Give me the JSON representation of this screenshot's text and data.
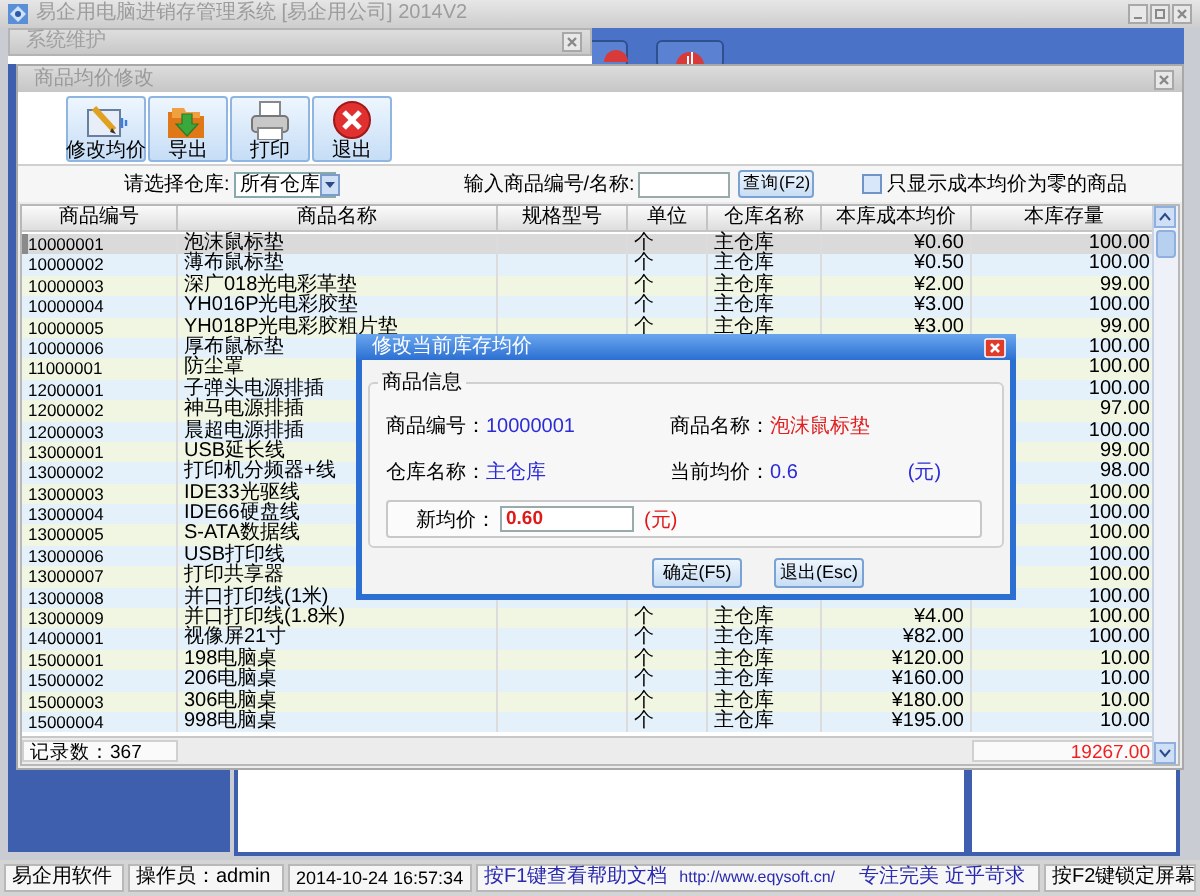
{
  "app_window": {
    "title": "易企用电脑进销存管理系统 [易企用公司] 2014V2"
  },
  "back_window": {
    "title": "系统维护"
  },
  "price_window": {
    "title": "商品均价修改",
    "toolbar": [
      {
        "label": "修改均价",
        "kind": "edit"
      },
      {
        "label": "导出",
        "kind": "export"
      },
      {
        "label": "打印",
        "kind": "print"
      },
      {
        "label": "退出",
        "kind": "exit"
      }
    ],
    "filter": {
      "warehouse_label": "请选择仓库:",
      "warehouse": "所有仓库",
      "search_label": "输入商品编号/名称:",
      "search_button": "查询(F2)",
      "only_zero_cost": {
        "label": "只显示成本均价为零的商品",
        "checked": false
      }
    },
    "table": {
      "columns": [
        "商品编号",
        "商品名称",
        "规格型号",
        "单位",
        "仓库名称",
        "本库成本均价",
        "本库存量"
      ],
      "rows": [
        {
          "code": "10000001",
          "name": "泡沫鼠标垫",
          "unit": "个",
          "warehouse": "主仓库",
          "price": "¥0.60",
          "stock": "100.00",
          "selected": true
        },
        {
          "code": "10000002",
          "name": "薄布鼠标垫",
          "unit": "个",
          "warehouse": "主仓库",
          "price": "¥0.50",
          "stock": "100.00",
          "selected": false
        },
        {
          "code": "10000003",
          "name": "深广018光电彩革垫",
          "unit": "个",
          "warehouse": "主仓库",
          "price": "¥2.00",
          "stock": "99.00",
          "selected": false
        },
        {
          "code": "10000004",
          "name": "YH016P光电彩胶垫",
          "unit": "个",
          "warehouse": "主仓库",
          "price": "¥3.00",
          "stock": "100.00",
          "selected": false
        },
        {
          "code": "10000005",
          "name": "YH018P光电彩胶粗片垫",
          "unit": "个",
          "warehouse": "主仓库",
          "price": "¥3.00",
          "stock": "99.00",
          "selected": false
        },
        {
          "code": "10000006",
          "name": "厚布鼠标垫",
          "stock": "100.00",
          "selected": false
        },
        {
          "code": "11000001",
          "name": "防尘罩",
          "stock": "100.00",
          "selected": false
        },
        {
          "code": "12000001",
          "name": "子弹头电源排插",
          "stock": "100.00",
          "selected": false
        },
        {
          "code": "12000002",
          "name": "神马电源排插",
          "stock": "97.00",
          "selected": false
        },
        {
          "code": "12000003",
          "name": "晨超电源排插",
          "stock": "100.00",
          "selected": false
        },
        {
          "code": "13000001",
          "name": "USB延长线",
          "stock": "99.00",
          "selected": false
        },
        {
          "code": "13000002",
          "name": "打印机分频器+线",
          "stock": "98.00",
          "selected": false
        },
        {
          "code": "13000003",
          "name": "IDE33光驱线",
          "stock": "100.00",
          "selected": false
        },
        {
          "code": "13000004",
          "name": "IDE66硬盘线",
          "stock": "100.00",
          "selected": false
        },
        {
          "code": "13000005",
          "name": "S-ATA数据线",
          "stock": "100.00",
          "selected": false
        },
        {
          "code": "13000006",
          "name": "USB打印线",
          "stock": "100.00",
          "selected": false
        },
        {
          "code": "13000007",
          "name": "打印共享器",
          "stock": "100.00",
          "selected": false
        },
        {
          "code": "13000008",
          "name": "并口打印线(1米)",
          "stock": "100.00",
          "selected": false
        },
        {
          "code": "13000009",
          "name": "并口打印线(1.8米)",
          "unit": "个",
          "warehouse": "主仓库",
          "price": "¥4.00",
          "stock": "100.00",
          "selected": false
        },
        {
          "code": "14000001",
          "name": "视像屏21寸",
          "unit": "个",
          "warehouse": "主仓库",
          "price": "¥82.00",
          "stock": "100.00",
          "selected": false
        },
        {
          "code": "15000001",
          "name": "198电脑桌",
          "unit": "个",
          "warehouse": "主仓库",
          "price": "¥120.00",
          "stock": "10.00",
          "selected": false
        },
        {
          "code": "15000002",
          "name": "206电脑桌",
          "unit": "个",
          "warehouse": "主仓库",
          "price": "¥160.00",
          "stock": "10.00",
          "selected": false
        },
        {
          "code": "15000003",
          "name": "306电脑桌",
          "unit": "个",
          "warehouse": "主仓库",
          "price": "¥180.00",
          "stock": "10.00",
          "selected": false
        },
        {
          "code": "15000004",
          "name": "998电脑桌",
          "unit": "个",
          "warehouse": "主仓库",
          "price": "¥195.00",
          "stock": "10.00",
          "selected": false
        }
      ]
    },
    "record_count": "记录数：367",
    "stock_total": "19267.00"
  },
  "dialog": {
    "title": "修改当前库存均价",
    "group": "商品信息",
    "fields": [
      {
        "label": "商品编号：",
        "value": "10000001",
        "color": "#2b2bd8"
      },
      {
        "label": "商品名称：",
        "value": "泡沫鼠标垫",
        "color": "#e02020"
      },
      {
        "label": "仓库名称：",
        "value": "主仓库",
        "color": "#2b2bd8"
      },
      {
        "label": "当前均价：",
        "value": "0.6",
        "color": "#2b2bd8",
        "unit": "(元)"
      }
    ],
    "new_price": {
      "label": "新均价：",
      "value": "0.60",
      "unit": "(元)"
    },
    "buttons": [
      "确定(F5)",
      "退出(Esc)"
    ]
  },
  "status_bar": {
    "product": "易企用软件",
    "operator": "操作员：admin",
    "time": "2014-10-24 16:57:34",
    "help": "按F1键查看帮助文档",
    "url": "http://www.eqysoft.cn/",
    "slogan": "专注完美 近乎苛求",
    "lock_hint": "按F2键锁定屏幕"
  }
}
